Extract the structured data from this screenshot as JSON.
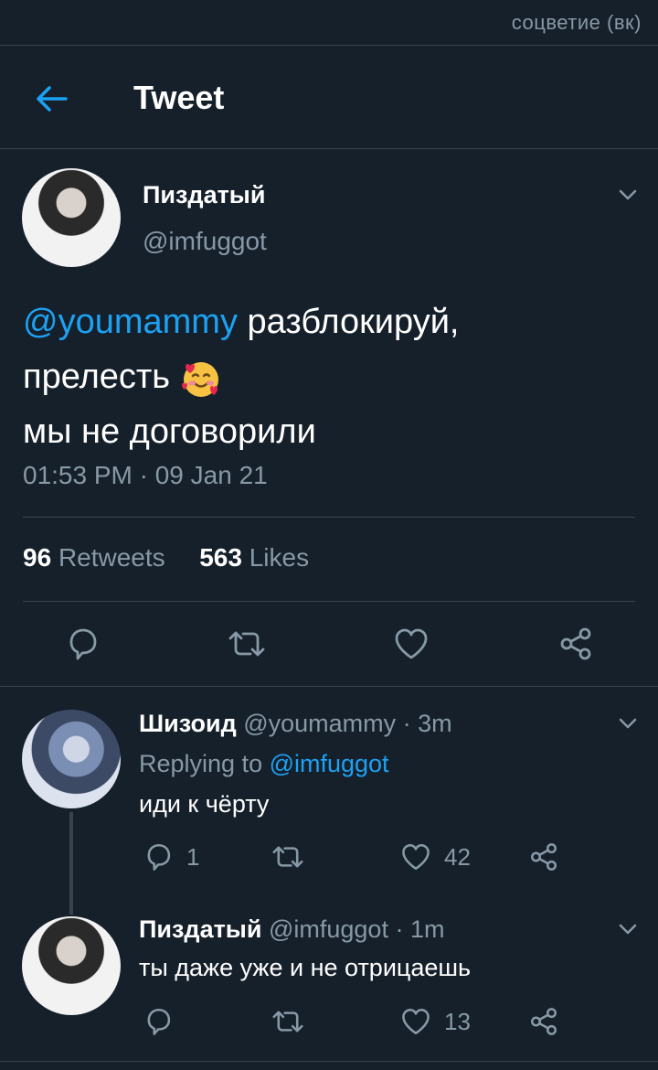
{
  "watermark": "соцветие (вк)",
  "header": {
    "title": "Tweet"
  },
  "main_tweet": {
    "display_name": "Пиздатый",
    "handle": "@imfuggot",
    "mention": "@youmammy",
    "text_part1": " разблокируй,",
    "text_line2": "прелесть",
    "emoji": "smiling-face-with-hearts",
    "text_line3": "мы не договорили",
    "timestamp": "01:53 PM · 09 Jan 21",
    "retweets_count": "96",
    "retweets_label": "Retweets",
    "likes_count": "563",
    "likes_label": "Likes"
  },
  "replies": [
    {
      "display_name": "Шизоид",
      "meta": "@youmammy · 3m",
      "replying_prefix": "Replying to ",
      "replying_to": "@imfuggot",
      "text": "иди к чёрту",
      "reply_count": "1",
      "retweet_count": "",
      "like_count": "42"
    },
    {
      "display_name": "Пиздатый",
      "meta": "@imfuggot · 1m",
      "text": "ты даже уже и не отрицаешь",
      "reply_count": "",
      "retweet_count": "",
      "like_count": "13"
    }
  ],
  "colors": {
    "background": "#15202b",
    "accent": "#1da1f2",
    "muted": "#8899a6",
    "divider": "#38444d"
  },
  "icons": [
    "back-arrow-icon",
    "chevron-down-icon",
    "reply-icon",
    "retweet-icon",
    "like-icon",
    "share-icon"
  ]
}
